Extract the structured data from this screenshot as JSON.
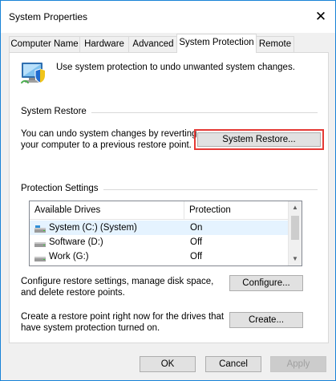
{
  "window": {
    "title": "System Properties",
    "close_glyph": "✕"
  },
  "tabs": [
    {
      "label": "Computer Name",
      "active": false
    },
    {
      "label": "Hardware",
      "active": false
    },
    {
      "label": "Advanced",
      "active": false
    },
    {
      "label": "System Protection",
      "active": true
    },
    {
      "label": "Remote",
      "active": false
    }
  ],
  "intro_text": "Use system protection to undo unwanted system changes.",
  "system_restore": {
    "group_label": "System Restore",
    "description_line1": "You can undo system changes by reverting",
    "description_line2": "your computer to a previous restore point.",
    "button_label": "System Restore..."
  },
  "protection_settings": {
    "group_label": "Protection Settings",
    "columns": [
      "Available Drives",
      "Protection"
    ],
    "drives": [
      {
        "name": "System (C:) (System)",
        "protection": "On",
        "icon": "system-drive-icon"
      },
      {
        "name": "Software (D:)",
        "protection": "Off",
        "icon": "drive-icon"
      },
      {
        "name": "Work (G:)",
        "protection": "Off",
        "icon": "drive-icon"
      }
    ],
    "configure_text_line1": "Configure restore settings, manage disk space,",
    "configure_text_line2": "and delete restore points.",
    "configure_button": "Configure...",
    "create_text_line1": "Create a restore point right now for the drives that",
    "create_text_line2": "have system protection turned on.",
    "create_button": "Create..."
  },
  "footer": {
    "ok": "OK",
    "cancel": "Cancel",
    "apply": "Apply"
  },
  "colors": {
    "window_border": "#1883d7",
    "highlight": "#e53935",
    "selected_row": "#e5f3ff"
  }
}
